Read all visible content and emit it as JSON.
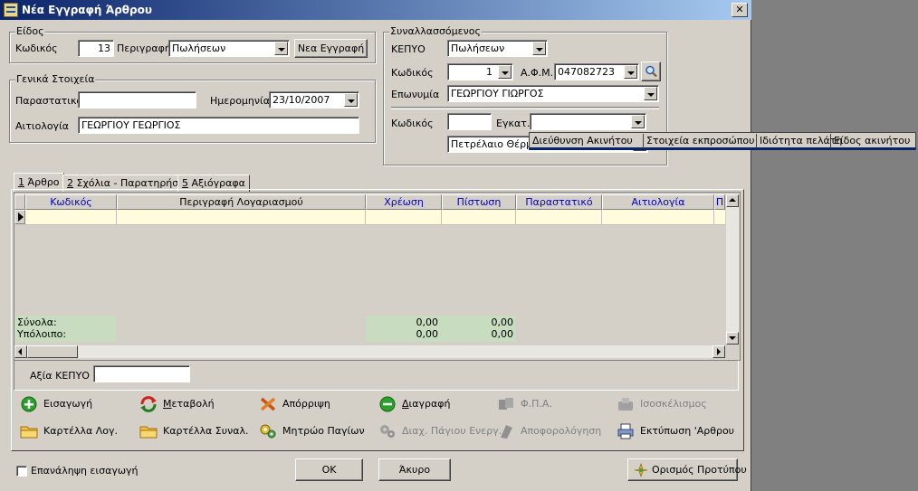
{
  "window": {
    "title": "Νέα Εγγραφή Άρθρου",
    "close_label": "✕"
  },
  "eidos": {
    "legend": "Είδος",
    "kodikos_label": "Κωδικός",
    "kodikos_value": "13",
    "perigrafi_label": "Περιγραφή",
    "perigrafi_value": "Πωλήσεων",
    "new_entry_button": "Νεα Εγγραφή"
  },
  "genika": {
    "legend": "Γενικά Στοιχεία",
    "parastatiko_label": "Παραστατικό",
    "parastatiko_value": "",
    "imerominia_label": "Ημερομηνία",
    "imerominia_value": "23/10/2007",
    "aitiologia_label": "Αιτιολογία",
    "aitiologia_value": "ΓΕΩΡΓΙΟΥ ΓΕΩΡΓΙΟΣ"
  },
  "synallassomenos": {
    "legend": "Συναλλασσόμενος",
    "kepyo_label": "ΚΕΠΥΟ",
    "kepyo_value": "Πωλήσεων",
    "kodikos_label": "Κωδικός",
    "kodikos_value": "1",
    "afm_label": "Α.Φ.Μ.",
    "afm_value": "047082723",
    "eponymia_label": "Επωνυμία",
    "eponymia_value": "ΓΕΩΡΓΙΟΥ ΓΙΩΡΓΟΣ",
    "kodikos2_label": "Κωδικός",
    "kodikos2_value": "",
    "egkat_label": "Εγκατ.",
    "egkat_value": "",
    "product_value": "Πετρέλαιο Θέρμαν"
  },
  "popup_menu": [
    "Διεύθυνση Ακινήτου",
    "Στοιχεία εκπροσώπου",
    "Ιδιότητα πελάτη",
    "Είδος ακινήτου"
  ],
  "tabs": [
    {
      "hotkey": "1",
      "label": " Άρθρο"
    },
    {
      "hotkey": "2",
      "label": " Σχόλια - Παρατηρήσεις"
    },
    {
      "hotkey": "5",
      "label": " Αξιόγραφα"
    }
  ],
  "grid": {
    "columns": [
      "Κωδικός",
      "Περιγραφή Λογαριασμού",
      "Χρέωση",
      "Πίστωση",
      "Παραστατικό",
      "Αιτιολογία",
      "Π"
    ],
    "totals_label": "Σύνολα:",
    "balance_label": "Υπόλοιπο:",
    "debit_total": "0,00",
    "debit_balance": "0,00",
    "credit_total": "0,00",
    "credit_balance": "0,00"
  },
  "axia_kepyo": {
    "label": "Αξία ΚΕΠΥΟ",
    "value": ""
  },
  "actions": {
    "eisagogi": "Εισαγωγή",
    "metavoli_hotkey": "Μ",
    "metavoli_rest": "εταβολή",
    "aporripsi": "Απόρριψη",
    "diagrafi_hotkey": "Δ",
    "diagrafi_rest": "ιαγραφή",
    "fpa": "Φ.Π.Α.",
    "isoskelismos": "Ισοσκέλισμος",
    "kartella_log": "Καρτέλλα Λογ.",
    "kartella_synal": "Καρτέλλα Συναλ.",
    "mitroo": "Μητρώο Παγίων",
    "diax_pagiou": "Διαχ. Πάγιου Ενεργ.",
    "apoforologisi": "Αποφορολόγηση",
    "ektyposi": "Εκτύπωση 'Αρθρου"
  },
  "footer": {
    "repeat_label": "Επανάληψη εισαγωγή",
    "ok": "OK",
    "cancel": "Άκυρο",
    "template": "Ορισμός Προτύπου"
  },
  "colors": {
    "title_start": "#0a246a",
    "title_end": "#a6caf0",
    "header_text": "#0000c8",
    "totals_bg": "#c8dcc0",
    "row_bg": "#fffbdc"
  }
}
